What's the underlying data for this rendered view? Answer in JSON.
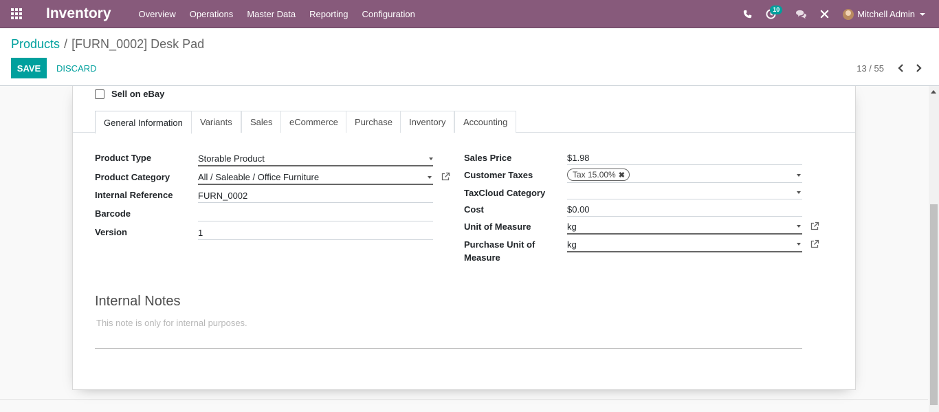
{
  "navbar": {
    "app_title": "Inventory",
    "menu": [
      "Overview",
      "Operations",
      "Master Data",
      "Reporting",
      "Configuration"
    ],
    "activity_count": "10",
    "user_name": "Mitchell Admin"
  },
  "control_panel": {
    "breadcrumb_parent": "Products",
    "breadcrumb_separator": "/",
    "breadcrumb_current": "[FURN_0002] Desk Pad",
    "save_label": "SAVE",
    "discard_label": "DISCARD",
    "pager": "13 / 55"
  },
  "form": {
    "sell_on_ebay_label": "Sell on eBay",
    "tabs": [
      "General Information",
      "Variants",
      "Sales",
      "eCommerce",
      "Purchase",
      "Inventory",
      "Accounting"
    ],
    "left_fields": {
      "product_type": {
        "label": "Product Type",
        "value": "Storable Product"
      },
      "product_category": {
        "label": "Product Category",
        "value": "All / Saleable / Office Furniture"
      },
      "internal_reference": {
        "label": "Internal Reference",
        "value": "FURN_0002"
      },
      "barcode": {
        "label": "Barcode",
        "value": ""
      },
      "version": {
        "label": "Version",
        "value": "1"
      }
    },
    "right_fields": {
      "sales_price": {
        "label": "Sales Price",
        "value": "$1.98"
      },
      "customer_taxes": {
        "label": "Customer Taxes",
        "tag": "Tax 15.00%"
      },
      "taxcloud_category": {
        "label": "TaxCloud Category",
        "value": ""
      },
      "cost": {
        "label": "Cost",
        "value": "$0.00"
      },
      "uom": {
        "label": "Unit of Measure",
        "value": "kg"
      },
      "purchase_uom": {
        "label_line1": "Purchase Unit of",
        "label_line2": "Measure",
        "value": "kg"
      }
    },
    "notes": {
      "title": "Internal Notes",
      "placeholder": "This note is only for internal purposes."
    }
  },
  "colors": {
    "navbar": "#875a7b",
    "accent": "#00a09d"
  }
}
